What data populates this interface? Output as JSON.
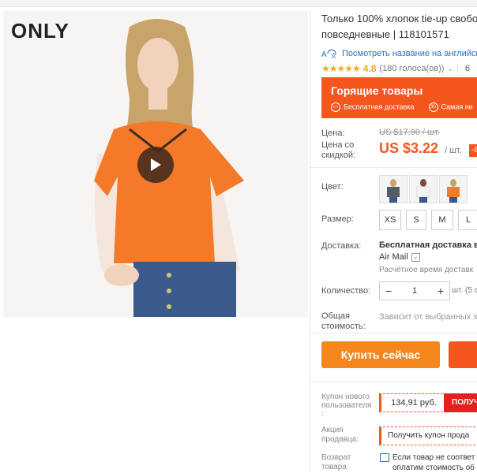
{
  "brand": {
    "logo_text": "ONLY"
  },
  "product": {
    "title_line1": "Только 100% хлопок tie-up свобо",
    "title_line2": "повседневные | 118101571",
    "translate_link": "Посмотреть название на английск",
    "rating_value": "4.8",
    "rating_count": "(180 голоса(ов))",
    "orders_prefix": "6"
  },
  "hot_deals": {
    "title": "Горящие товары",
    "free_delivery": "Бесплатная доставка",
    "days_badge": "30",
    "cheapest": "Самая ни"
  },
  "price": {
    "label": "Цена:",
    "old_value": "US $17.90 / шт.",
    "discount_label_line1": "Цена со",
    "discount_label_line2": "скидкой:",
    "new_value": "US $3.22",
    "unit": "/ шт.",
    "discount_badge": "-8"
  },
  "color": {
    "label": "Цвет:"
  },
  "size": {
    "label": "Размер:",
    "options": [
      "XS",
      "S",
      "M",
      "L"
    ]
  },
  "delivery": {
    "label": "Доставка:",
    "main": "Бесплатная доставка в",
    "carrier": "Air Mail",
    "time": "Расчётное время доставк"
  },
  "quantity": {
    "label": "Количество:",
    "value": "1",
    "minus": "−",
    "plus": "+",
    "note": "шт. (5 с"
  },
  "total": {
    "label_line1": "Общая",
    "label_line2": "стоимость:",
    "value": "Зависит от выбранных ха"
  },
  "actions": {
    "buy_now": "Купить сейчас"
  },
  "coupons": {
    "new_user_label_line1": "Купон нового",
    "new_user_label_line2": "пользователя",
    "new_user_label_line3": ":",
    "new_user_value": "134,91 руб.",
    "get_label": "ПОЛУЧ",
    "seller_label_line1": "Акция",
    "seller_label_line2": "продавца:",
    "seller_value": "Получить купон прода"
  },
  "returns": {
    "label_line1": "Возврат",
    "label_line2": "товара",
    "text_line1": "Если товар не соответ",
    "text_line2": "оплатим стоимость об"
  },
  "colors": {
    "accent": "#f5561e",
    "buy_button": "#f5861e",
    "link": "#2a6ebb",
    "star": "#f5a623"
  }
}
